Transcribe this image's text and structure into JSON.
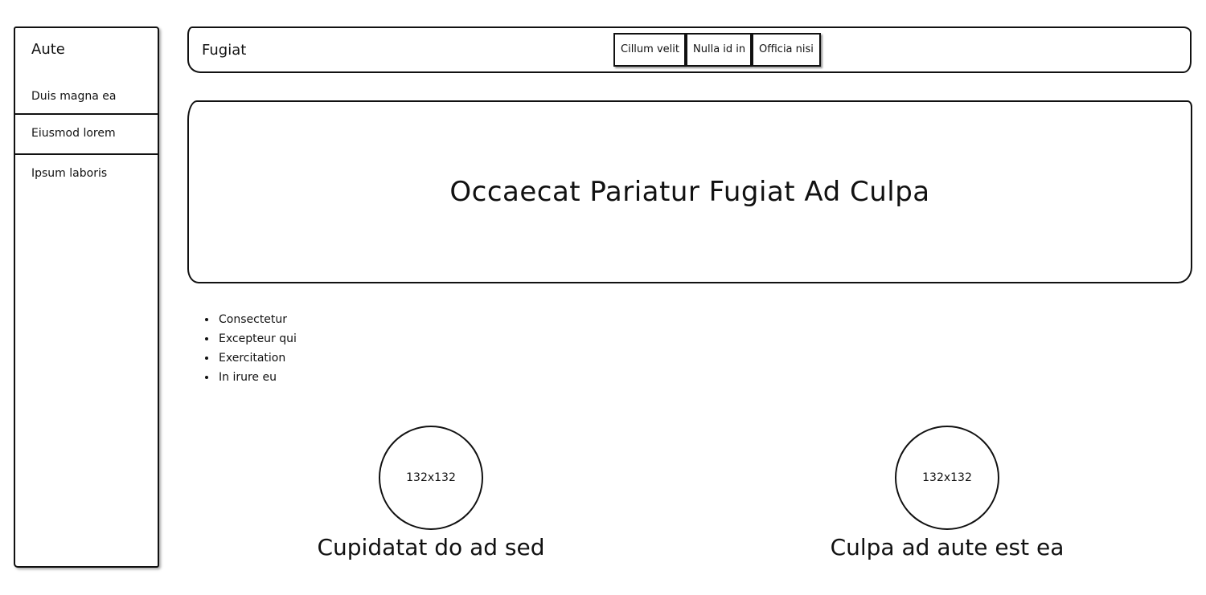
{
  "sidebar": {
    "title": "Aute",
    "items": [
      {
        "label": "Duis magna ea"
      },
      {
        "label": "Eiusmod lorem"
      },
      {
        "label": "Ipsum laboris"
      }
    ]
  },
  "header": {
    "title": "Fugiat",
    "buttons": [
      {
        "label": "Cillum velit"
      },
      {
        "label": "Nulla id in"
      },
      {
        "label": "Officia nisi"
      }
    ]
  },
  "hero": {
    "title": "Occaecat Pariatur Fugiat Ad Culpa"
  },
  "list": {
    "items": [
      "Consectetur",
      "Excepteur qui",
      "Exercitation",
      "In irure eu"
    ]
  },
  "cards": [
    {
      "image_label": "132x132",
      "caption": "Cupidatat do ad sed"
    },
    {
      "image_label": "132x132",
      "caption": "Culpa ad aute est ea"
    }
  ]
}
